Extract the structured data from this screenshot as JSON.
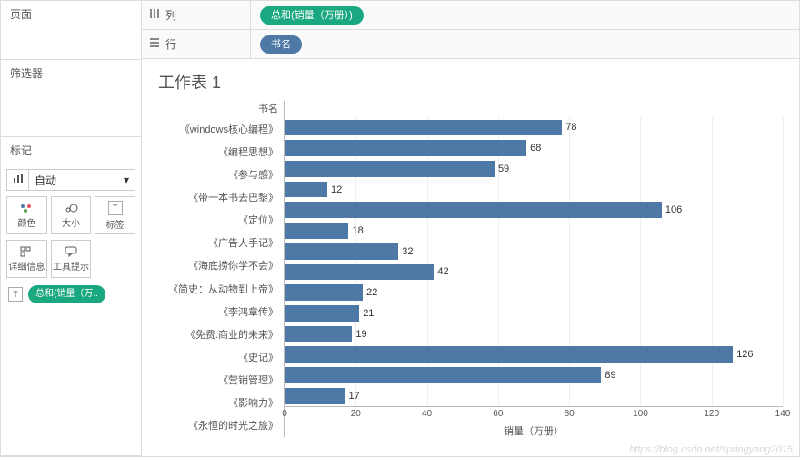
{
  "panels": {
    "pages": "页面",
    "filters": "筛选器",
    "marks": "标记"
  },
  "marks": {
    "type_label": "自动",
    "cells": {
      "color": "颜色",
      "size": "大小",
      "label": "标签",
      "detail": "详细信息",
      "tooltip": "工具提示"
    },
    "pill_label": "总和(销量（万.."
  },
  "shelves": {
    "columns_label": "列",
    "rows_label": "行",
    "columns_pill": "总和(销量（万册）)",
    "rows_pill": "书名"
  },
  "sheet_title": "工作表 1",
  "chart_data": {
    "type": "bar",
    "orientation": "horizontal",
    "y_header": "书名",
    "xlabel": "销量（万册）",
    "xlim": [
      0,
      140
    ],
    "xticks": [
      0,
      20,
      40,
      60,
      80,
      100,
      120,
      140
    ],
    "categories": [
      "《windows核心编程》",
      "《编程思想》",
      "《参与感》",
      "《带一本书去巴黎》",
      "《定位》",
      "《广告人手记》",
      "《海底捞你学不会》",
      "《简史：从动物到上帝》",
      "《李鸿章传》",
      "《免费:商业的未来》",
      "《史记》",
      "《营销管理》",
      "《影响力》",
      "《永恒的时光之旅》"
    ],
    "values": [
      78,
      68,
      59,
      12,
      106,
      18,
      32,
      42,
      22,
      21,
      19,
      126,
      89,
      17
    ]
  },
  "watermark": "https://blog.csdn.net/springyang2015"
}
